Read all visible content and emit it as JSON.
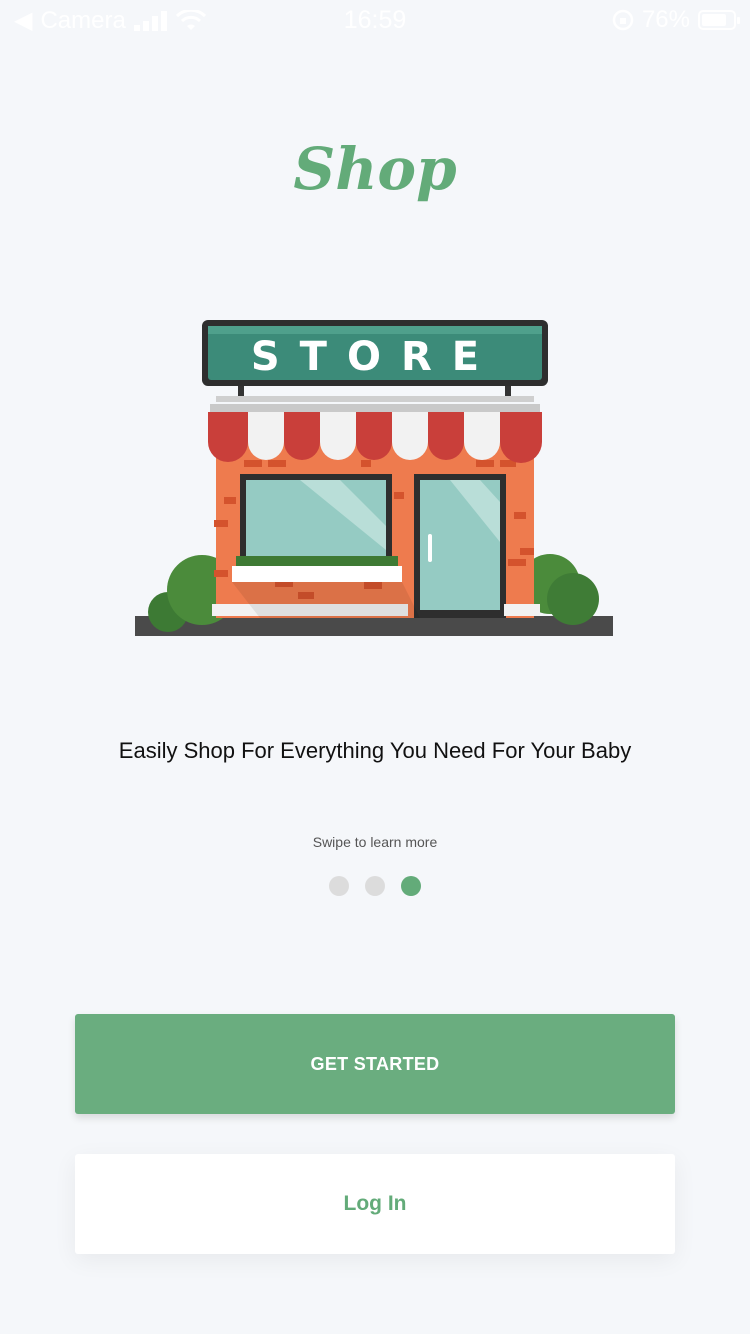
{
  "status_bar": {
    "back_label": "Camera",
    "time": "16:59",
    "battery_percent": "76%"
  },
  "logo": {
    "text": "Shop"
  },
  "illustration": {
    "sign_text": "STORE"
  },
  "onboarding": {
    "tagline": "Easily Shop For Everything You Need For Your Baby",
    "swipe_hint": "Swipe to learn more",
    "pages_total": 3,
    "active_page": 3
  },
  "actions": {
    "get_started_label": "GET STARTED",
    "login_label": "Log In"
  },
  "colors": {
    "brand_green": "#63ab79",
    "button_green": "#6aad7f",
    "background": "#f5f7fa"
  }
}
